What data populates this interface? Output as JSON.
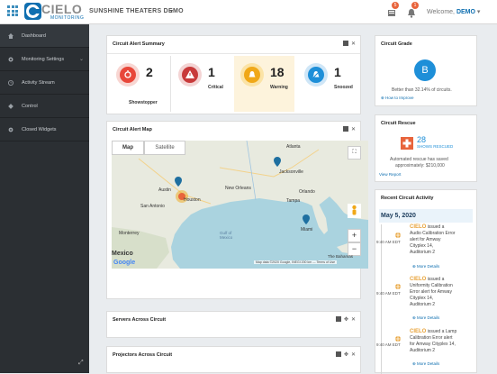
{
  "header": {
    "logo_word": "CIELO",
    "logo_sub": "MONITORING",
    "app_title": "SUNSHINE THEATERS DEMO",
    "notification_badges": [
      "5",
      "1"
    ],
    "welcome_prefix": "Welcome,",
    "welcome_user": "DEMO"
  },
  "sidebar": {
    "items": [
      {
        "label": "Dashboard",
        "icon": "home-icon"
      },
      {
        "label": "Monitoring Settings",
        "icon": "gear-icon"
      },
      {
        "label": "Activity Stream",
        "icon": "clock-icon"
      },
      {
        "label": "Control",
        "icon": "remote-icon"
      },
      {
        "label": "Closed Widgets",
        "icon": "settings-icon"
      }
    ]
  },
  "alert_summary": {
    "title": "Circuit Alert Summary",
    "items": [
      {
        "count": "2",
        "label": "Showstopper",
        "color": "#e8473a"
      },
      {
        "count": "1",
        "label": "Critical",
        "color": "#c83a3a"
      },
      {
        "count": "18",
        "label": "Warning",
        "color": "#f0a818"
      },
      {
        "count": "1",
        "label": "Snoozed",
        "color": "#1e8fd8"
      }
    ]
  },
  "alert_map": {
    "title": "Circuit Alert Map",
    "tab_map": "Map",
    "tab_satellite": "Satellite",
    "footer": "Map data ©2020 Google, INEGI   200 km ⎯⎯   Terms of Use",
    "google": "Google",
    "cities": [
      "Austin",
      "Houston",
      "San Antonio",
      "New Orleans",
      "Jacksonville",
      "Orlando",
      "Tampa",
      "Miami",
      "Atlanta",
      "Monterrey",
      "Mexico",
      "Gulf of Mexico",
      "The Bahamas"
    ],
    "zoom_in": "+",
    "zoom_out": "−"
  },
  "servers": {
    "title": "Servers Across Circuit"
  },
  "projectors": {
    "title": "Projectors Across Circuit"
  },
  "grade": {
    "title": "Circuit Grade",
    "grade": "B",
    "text": "Better than 32.14% of circuits.",
    "link": "How to Improve"
  },
  "rescue": {
    "title": "Circuit Rescue",
    "count": "28",
    "count_label": "SHOWS RESCUED",
    "text_1": "Automated rescue has saved",
    "text_2": "approximately: $210,000",
    "link": "View Report"
  },
  "activity": {
    "title": "Recent Circuit Activity",
    "date": "May 5, 2020",
    "entries": [
      {
        "time": "9:40 AM EDT",
        "brand": "CIELO",
        "lines": [
          "issued a",
          "Audio Calibration Error",
          "alert for Amway",
          "Cityplex 14,",
          "Auditorium 2"
        ],
        "more": "More Details"
      },
      {
        "time": "9:40 AM EDT",
        "brand": "CIELO",
        "lines": [
          "issued a",
          "Uniformity Calibration",
          "Error alert for Amway",
          "Cityplex 14,",
          "Auditorium 2"
        ],
        "more": "More Details"
      },
      {
        "time": "9:40 AM EDT",
        "brand": "CIELO",
        "lines": [
          "issued a Lamp",
          "Calibration Error alert",
          "for Amway Cityplex 14,",
          "Auditorium 2"
        ],
        "more": "More Details"
      }
    ]
  },
  "colors": {
    "accent": "#0f6fb0",
    "orange": "#e8643c",
    "sidebar": "#2b2f33",
    "cielo_orange": "#e8a33a"
  }
}
